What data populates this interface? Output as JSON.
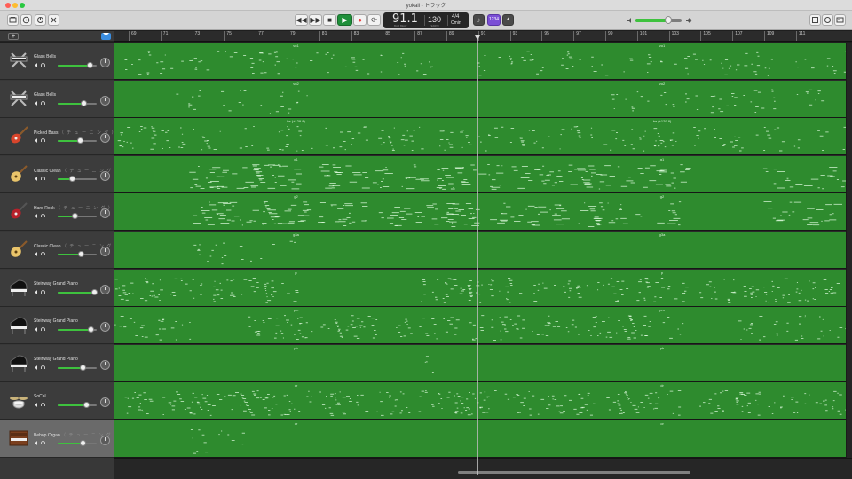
{
  "window": {
    "title": "yokaii - トラック"
  },
  "toolbar": {
    "rewind_label": "◀◀",
    "forward_label": "▶▶",
    "stop_label": "■",
    "play_label": "▶",
    "record_label": "●",
    "cycle_label": "⟳",
    "tuner_label": "♪",
    "count_in_label": "1234",
    "metronome_label": "▲",
    "left_icons": [
      "library-icon",
      "help-icon",
      "smart-controls-icon",
      "editors-icon"
    ],
    "right_icons": [
      "notepad-icon",
      "loop-browser-icon",
      "media-browser-icon"
    ]
  },
  "lcd": {
    "position": "91.1",
    "position_sub": "BAR   BEAT",
    "tempo": "130",
    "tempo_sub": "TEMPO",
    "signature": "4/4",
    "key": "Cmin"
  },
  "master_volume": {
    "level": 0.72
  },
  "ruler": {
    "bars": [
      "69",
      "71",
      "73",
      "75",
      "77",
      "79",
      "81",
      "83",
      "85",
      "87",
      "89",
      "91",
      "93",
      "95",
      "97",
      "99",
      "101",
      "103",
      "105",
      "107",
      "109",
      "111"
    ]
  },
  "tracks": [
    {
      "name": "Glass Bells",
      "smart": "",
      "icon": "keyboard-stand-icon",
      "volume": 0.82,
      "selected": false,
      "regions": [
        "vo1",
        "vo1"
      ]
    },
    {
      "name": "Glass Bells",
      "smart": "",
      "icon": "keyboard-stand-icon",
      "volume": 0.68,
      "selected": false,
      "regions": [
        "vo2",
        "vo2"
      ]
    },
    {
      "name": "Picked Bass",
      "smart": "（ チ ュ ー ニ ン グ ）",
      "icon": "bass-guitar-icon",
      "volume": 0.57,
      "selected": false,
      "regions": [
        "ba (+129.8)",
        "ba (+129.8)"
      ]
    },
    {
      "name": "Classic Clean",
      "smart": "（ チ ュ ー ニ ン グ ）",
      "icon": "electric-guitar-icon",
      "volume": 0.38,
      "selected": false,
      "regions": [
        "g1",
        "g1"
      ]
    },
    {
      "name": "Hard Rock",
      "smart": "（ チ ュ ー ニ ン グ ）",
      "icon": "red-guitar-icon",
      "volume": 0.44,
      "selected": false,
      "regions": [
        "g2",
        "g2"
      ]
    },
    {
      "name": "Classic Clean",
      "smart": "（ チ ュ ー ニ ン グ ）",
      "icon": "electric-guitar-icon",
      "volume": 0.6,
      "selected": false,
      "regions": [
        "g3a",
        "g3a"
      ]
    },
    {
      "name": "Steinway Grand Piano",
      "smart": "",
      "icon": "grand-piano-icon",
      "volume": 0.95,
      "selected": false,
      "regions": [
        "p",
        "p"
      ]
    },
    {
      "name": "Steinway Grand Piano",
      "smart": "",
      "icon": "grand-piano-icon",
      "volume": 0.86,
      "selected": false,
      "regions": [
        "pm",
        "pm"
      ]
    },
    {
      "name": "Steinway Grand Piano",
      "smart": "",
      "icon": "grand-piano-icon",
      "volume": 0.64,
      "selected": false,
      "regions": [
        "ph",
        "ph"
      ]
    },
    {
      "name": "SoCal",
      "smart": "",
      "icon": "drum-kit-icon",
      "volume": 0.73,
      "selected": false,
      "regions": [
        "dr",
        "dr"
      ]
    },
    {
      "name": "Bebop Organ",
      "smart": "（ チ ュ ー ニ ン グ ）",
      "icon": "organ-icon",
      "volume": 0.64,
      "selected": true,
      "regions": [
        "or",
        "or"
      ]
    }
  ],
  "colors": {
    "region": "#2e8b2e",
    "region_border": "#1f5f1f",
    "notes": "#e4ffe4",
    "volume_fill": "#3ec23e",
    "play_button": "#1f8f3a",
    "record": "#e83b3b",
    "count_in": "#7b4fd6"
  }
}
